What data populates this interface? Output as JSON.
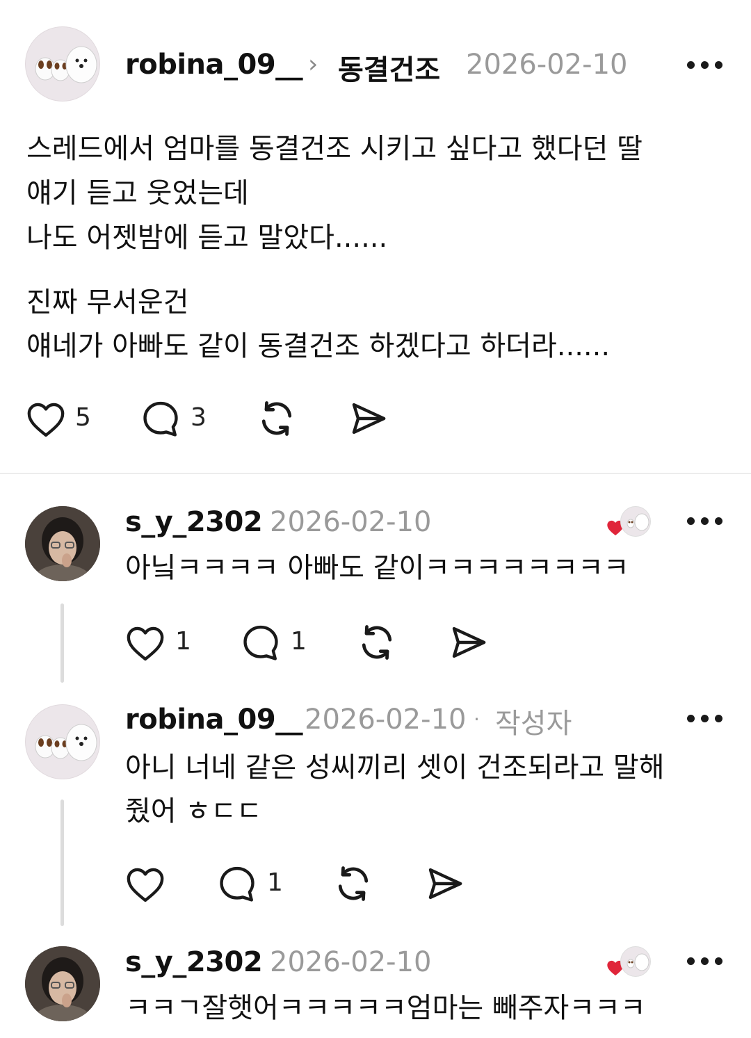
{
  "post": {
    "username": "robina_09__",
    "topic": "동결건조",
    "date": "2026-02-10",
    "lines": [
      "스레드에서 엄마를 동결건조 시키고 싶다고 했다던 딸",
      "얘기 듣고 웃었는데",
      "나도 어젯밤에 듣고 말았다......",
      "진짜 무서운건",
      "얘네가 아빠도 같이 동결건조 하겠다고 하더라......"
    ],
    "likes": "5",
    "comments": "3"
  },
  "replies": [
    {
      "username": "s_y_2302",
      "date": "2026-02-10",
      "lines": [
        "아닠ㅋㅋㅋㅋ 아빠도 같이ㅋㅋㅋㅋㅋㅋㅋㅋ"
      ],
      "likes": "1",
      "comments": "1"
    },
    {
      "username": "robina_09__",
      "date": "2026-02-10",
      "author_badge": "작성자",
      "lines": [
        "아니 너네 같은 성씨끼리 셋이 건조되라고 말해",
        "줬어 ㅎㄷㄷ"
      ],
      "likes": "",
      "comments": "1"
    },
    {
      "username": "s_y_2302",
      "date": "2026-02-10",
      "lines": [
        "ㅋㅋㄱ잘햇어ㅋㅋㅋㅋㅋ엄마는 빼주자ㅋㅋㅋ"
      ]
    }
  ],
  "icons": {
    "more": "more-dots-icon",
    "like": "heart-icon",
    "comment": "comment-bubble-icon",
    "repost": "repost-icon",
    "share": "send-icon"
  },
  "colors": {
    "liked_heart": "#e0253a",
    "muted_text": "#9a9a9a"
  }
}
